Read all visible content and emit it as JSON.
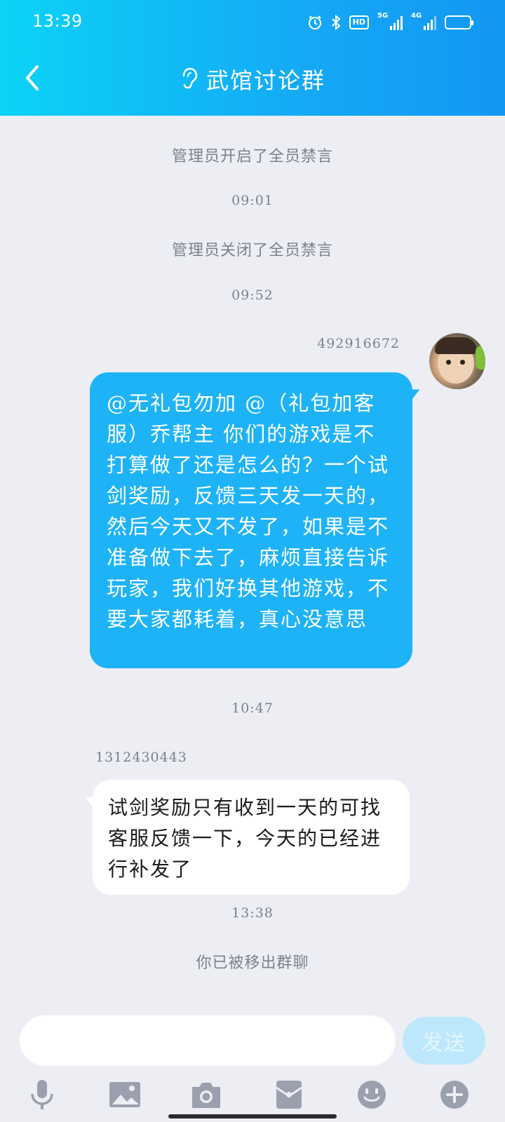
{
  "status_bar": {
    "time": "13:39",
    "network1": "5G",
    "network2": "4G",
    "hd": "HD"
  },
  "header": {
    "title": "武馆讨论群",
    "background_color": "#14a9f5"
  },
  "messages": {
    "notice_mute_on": "管理员开启了全员禁言",
    "time_1": "09:01",
    "notice_mute_off": "管理员关闭了全员禁言",
    "time_2": "09:52",
    "sender_1": "492916672",
    "message_1": "@无礼包勿加 @（礼包加客服）乔帮主 你们的游戏是不打算做了还是怎么的？一个试剑奖励，反馈三天发一天的，然后今天又不发了，如果是不准备做下去了，麻烦直接告诉玩家，我们好换其他游戏，不要大家都耗着，真心没意思",
    "time_3": "10:47",
    "sender_2": "1312430443",
    "message_2": "试剑奖励只有收到一天的可找客服反馈一下，今天的已经进行补发了",
    "time_4": "13:38",
    "notice_removed": "你已被移出群聊"
  },
  "composer": {
    "input_value": "",
    "send_label": "发送"
  },
  "toolbar_icons": [
    "microphone-icon",
    "image-icon",
    "camera-icon",
    "red-packet-icon",
    "emoji-icon",
    "plus-icon"
  ],
  "colors": {
    "accent": "#1eb3f7",
    "send_disabled": "#bde8fb",
    "background": "#eceef4",
    "icon_gray": "#9aa0ad"
  }
}
